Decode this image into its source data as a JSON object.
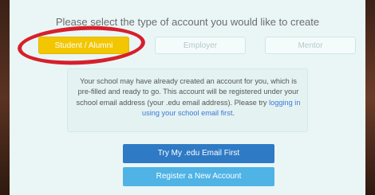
{
  "heading": "Please select the type of account you would like to create",
  "account_types": {
    "student": "Student / Alumni",
    "employer": "Employer",
    "mentor": "Mentor"
  },
  "info": {
    "text_before_link": "Your school may have already created an account for you, which is pre-filled and ready to go. This account will be registered under your school email address (your .edu email address). Please try ",
    "link_text": "logging in using your school email first",
    "text_after_link": "."
  },
  "buttons": {
    "edu_first": "Try My .edu Email First",
    "register": "Register a New Account"
  },
  "colors": {
    "selected_tab": "#f2c600",
    "highlight_ring": "#d6202c",
    "primary_button": "#2f7ac4",
    "secondary_button": "#4fb3e6",
    "link": "#3a7bd5"
  }
}
